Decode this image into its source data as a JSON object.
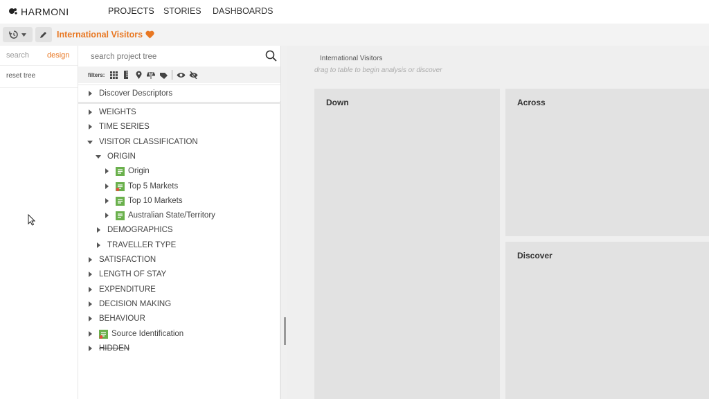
{
  "app": {
    "logo_text": "HARMONI"
  },
  "nav": {
    "tabs": [
      {
        "label": "PROJECTS",
        "active": true
      },
      {
        "label": "STORIES"
      },
      {
        "label": "DASHBOARDS"
      }
    ]
  },
  "project": {
    "title": "International Visitors",
    "favorite_icon": "heart-icon",
    "accent_color": "#e87722"
  },
  "left_rail": {
    "tabs": [
      "search",
      "design"
    ],
    "active_tab": "design",
    "reset_label": "reset tree"
  },
  "tree": {
    "search_placeholder": "search project tree",
    "filters_label": "filters:",
    "discover_label": "Discover Descriptors",
    "items": [
      {
        "label": "WEIGHTS",
        "expanded": false,
        "level": 0
      },
      {
        "label": "TIME SERIES",
        "expanded": false,
        "level": 0
      },
      {
        "label": "VISITOR CLASSIFICATION",
        "expanded": true,
        "level": 0
      },
      {
        "label": "ORIGIN",
        "expanded": true,
        "level": 1
      },
      {
        "label": "Origin",
        "level": 2,
        "icon": "variable-icon"
      },
      {
        "label": "Top 5 Markets",
        "level": 2,
        "icon": "variable-flag-icon"
      },
      {
        "label": "Top 10 Markets",
        "level": 2,
        "icon": "variable-icon"
      },
      {
        "label": "Australian State/Territory",
        "level": 2,
        "icon": "variable-icon"
      },
      {
        "label": "DEMOGRAPHICS",
        "expanded": false,
        "level": 1
      },
      {
        "label": "TRAVELLER TYPE",
        "expanded": false,
        "level": 1
      },
      {
        "label": "SATISFACTION",
        "expanded": false,
        "level": 0
      },
      {
        "label": "LENGTH OF STAY",
        "expanded": false,
        "level": 0
      },
      {
        "label": "EXPENDITURE",
        "expanded": false,
        "level": 0
      },
      {
        "label": "DECISION MAKING",
        "expanded": false,
        "level": 0
      },
      {
        "label": "BEHAVIOUR",
        "expanded": false,
        "level": 0
      },
      {
        "label": "Source Identification",
        "level": 0,
        "icon": "variable-flag-icon"
      },
      {
        "label": "HIDDEN",
        "expanded": false,
        "level": 0,
        "strikethrough": true
      }
    ]
  },
  "workspace": {
    "table_title": "International Visitors",
    "hint": "drag to table to begin analysis or discover",
    "zones": {
      "down": "Down",
      "across": "Across",
      "discover": "Discover"
    }
  }
}
